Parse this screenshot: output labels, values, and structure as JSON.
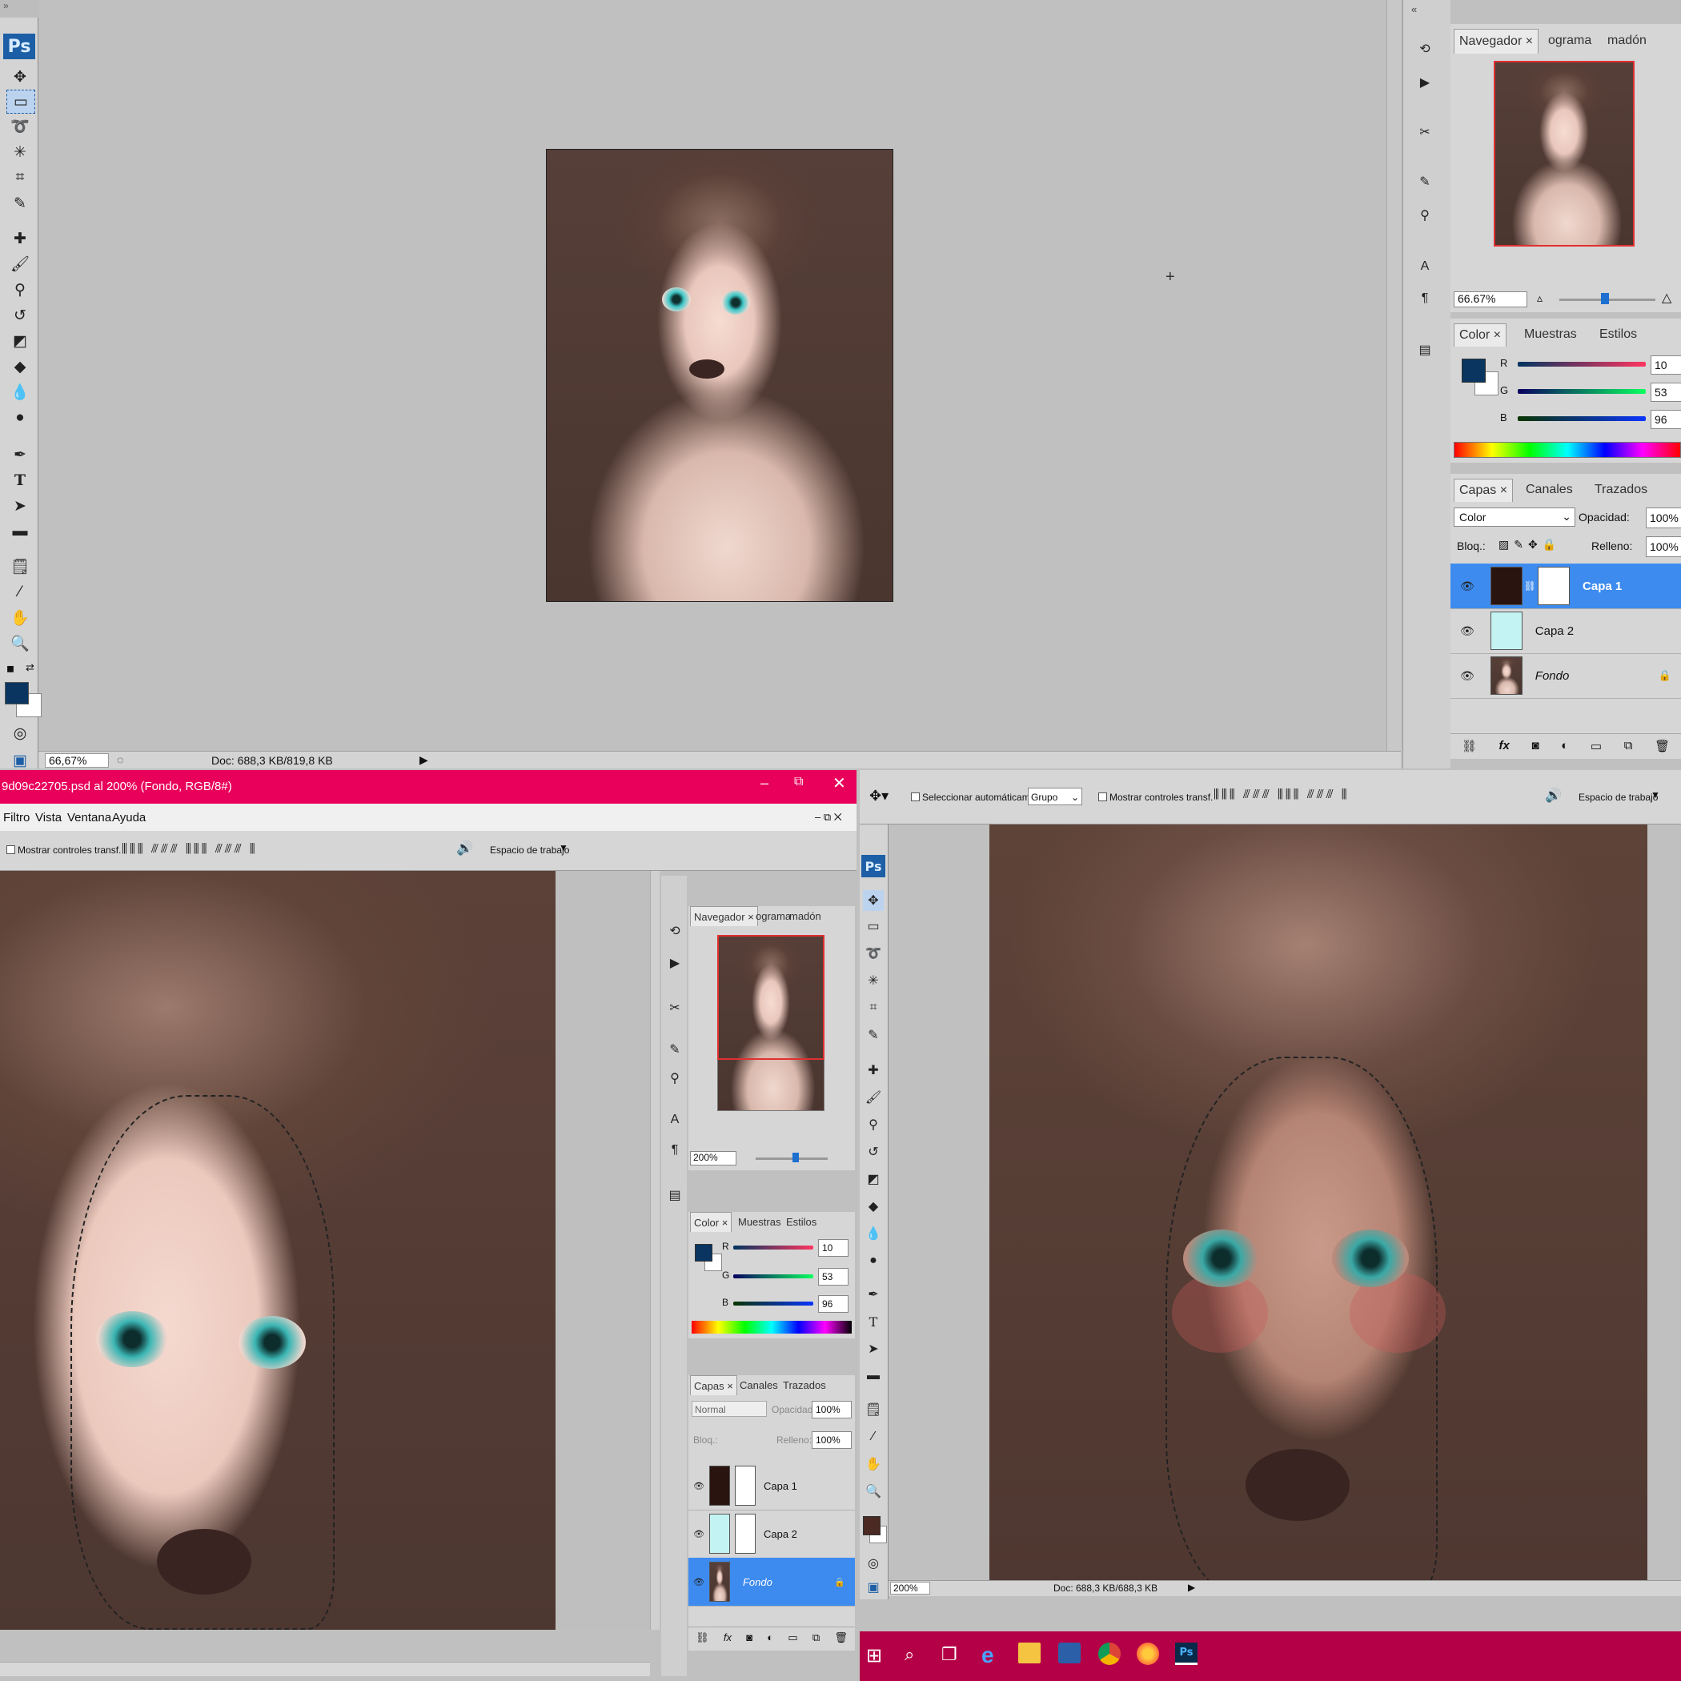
{
  "app": {
    "logo": "Ps"
  },
  "top_window": {
    "zoom": "66,67%",
    "doc_info": "Doc: 688,3 KB/819,8 KB",
    "navigator": {
      "tabs": [
        "Navegador",
        "ograma",
        "madón"
      ],
      "zoom": "66.67%"
    },
    "color_panel": {
      "tabs": [
        "Color",
        "Muestras",
        "Estilos"
      ],
      "r_label": "R",
      "g_label": "G",
      "b_label": "B",
      "r": "10",
      "g": "53",
      "b": "96",
      "fg_color": "#0a3560"
    },
    "layers_panel": {
      "tabs": [
        "Capas",
        "Canales",
        "Trazados"
      ],
      "blend_mode": "Color",
      "opacity_label": "Opacidad:",
      "opacity": "100%",
      "lock_label": "Bloq.:",
      "fill_label": "Relleno:",
      "fill": "100%",
      "layers": [
        {
          "name": "Capa 1",
          "selected": true
        },
        {
          "name": "Capa 2",
          "selected": false
        },
        {
          "name": "Fondo",
          "selected": false
        }
      ],
      "footer_icons": [
        "link-icon",
        "fx-icon",
        "mask-icon",
        "adjustment-icon",
        "folder-icon",
        "new-layer-icon",
        "trash-icon"
      ]
    }
  },
  "left_window": {
    "title": "9d09c22705.psd al 200% (Fondo, RGB/8#)",
    "title_bar_color": "#e8005a",
    "menu": [
      "Filtro",
      "Vista",
      "Ventana",
      "Ayuda"
    ],
    "options": {
      "show_transform": "Mostrar controles transf.",
      "workspace": "Espacio de trabajo"
    },
    "navigator": {
      "tabs": [
        "Navegador",
        "ograma",
        "madón"
      ],
      "zoom": "200%"
    },
    "color_panel": {
      "tabs": [
        "Color",
        "Muestras",
        "Estilos"
      ],
      "r_label": "R",
      "g_label": "G",
      "b_label": "B",
      "r": "10",
      "g": "53",
      "b": "96"
    },
    "layers_panel": {
      "tabs": [
        "Capas",
        "Canales",
        "Trazados"
      ],
      "blend_mode": "Normal",
      "opacity_label": "Opacidad:",
      "opacity": "100%",
      "lock_label": "Bloq.:",
      "fill_label": "Relleno:",
      "fill": "100%",
      "layers": [
        {
          "name": "Capa 1",
          "selected": false
        },
        {
          "name": "Capa 2",
          "selected": false
        },
        {
          "name": "Fondo",
          "selected": true
        }
      ]
    }
  },
  "right_window": {
    "options": {
      "auto_select": "Seleccionar automáticamente:",
      "group": "Grupo",
      "show_transform": "Mostrar controles transf.",
      "workspace": "Espacio de trabajo"
    },
    "zoom": "200%",
    "doc_info": "Doc: 688,3 KB/688,3 KB",
    "fg_color": "#4a2a22"
  },
  "taskbar": {
    "color": "#b40046",
    "icons": [
      "windows-start-icon",
      "search-icon",
      "task-view-icon",
      "edge-icon",
      "file-explorer-icon",
      "app-icon",
      "chrome-icon",
      "firefox-icon",
      "photoshop-icon"
    ],
    "ps_label": "Ps"
  }
}
